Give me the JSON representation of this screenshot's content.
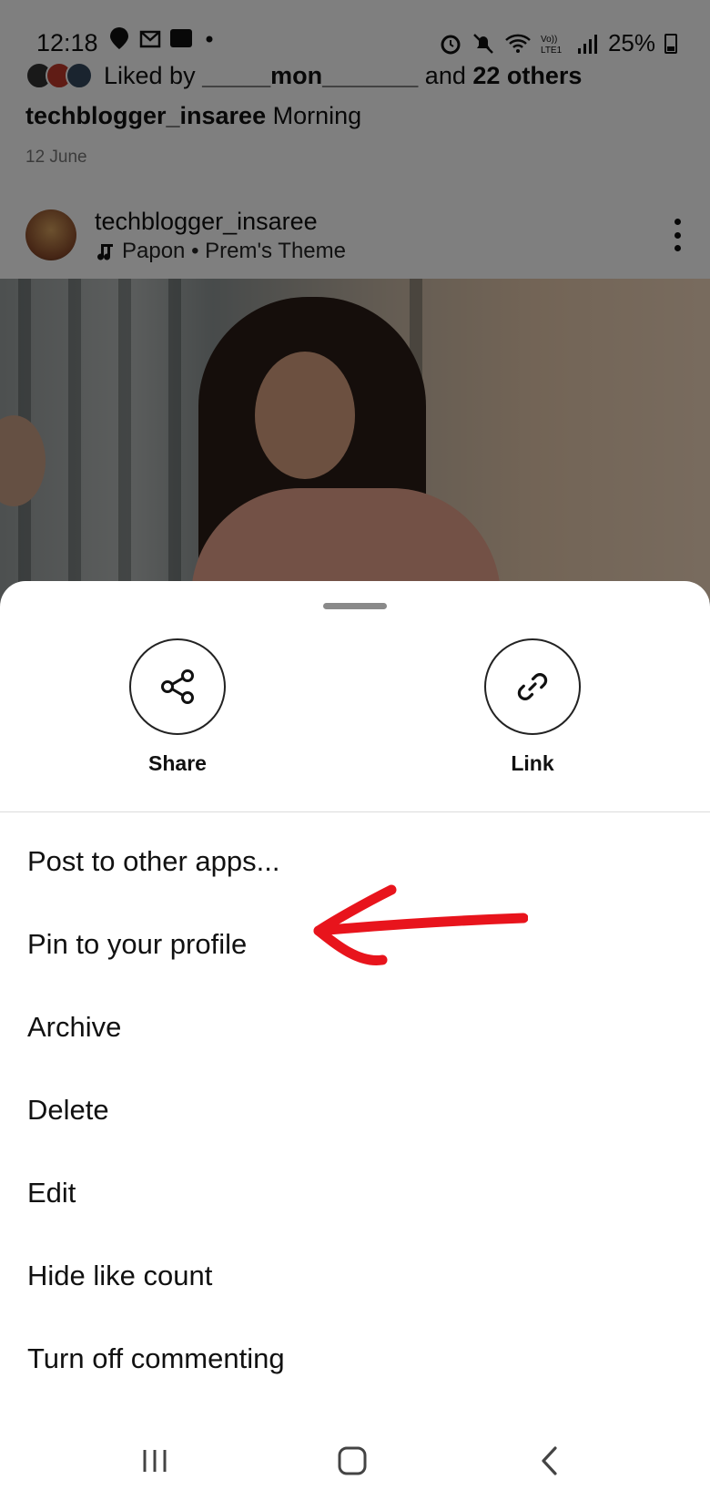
{
  "status_bar": {
    "time": "12:18",
    "battery": "25%"
  },
  "feed": {
    "liked_by_prefix": "Liked by",
    "liked_by_user": "_____mon_______",
    "liked_by_and": "and",
    "liked_by_others": "22 others",
    "caption_user": "techblogger_insaree",
    "caption_text": "Morning",
    "date": "12 June",
    "post_username": "techblogger_insaree",
    "post_music": "Papon • Prem's Theme"
  },
  "sheet": {
    "actions": [
      {
        "label": "Share",
        "icon": "share-icon"
      },
      {
        "label": "Link",
        "icon": "link-icon"
      }
    ],
    "menu": [
      "Post to other apps...",
      "Pin to your profile",
      "Archive",
      "Delete",
      "Edit",
      "Hide like count",
      "Turn off commenting"
    ]
  },
  "annotation": {
    "color": "#e8141c",
    "icon": "red-arrow-annotation"
  },
  "navbar": {
    "icons": [
      "recents-icon",
      "home-icon",
      "back-icon"
    ]
  }
}
